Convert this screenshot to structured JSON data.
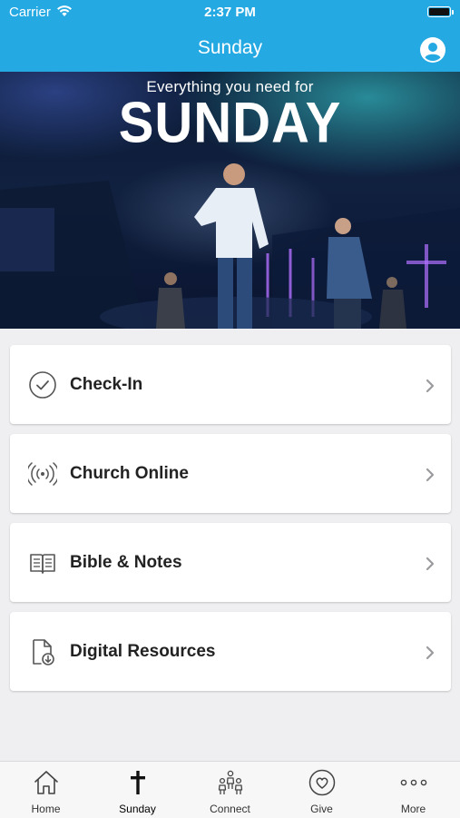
{
  "status_bar": {
    "carrier": "Carrier",
    "time": "2:37 PM"
  },
  "header": {
    "title": "Sunday"
  },
  "hero": {
    "line1": "Everything you need for",
    "line2": "SUNDAY"
  },
  "menu": [
    {
      "label": "Check-In",
      "icon": "check-circle-icon"
    },
    {
      "label": "Church Online",
      "icon": "broadcast-icon"
    },
    {
      "label": "Bible & Notes",
      "icon": "open-book-icon"
    },
    {
      "label": "Digital Resources",
      "icon": "file-download-icon"
    }
  ],
  "tabs": [
    {
      "label": "Home",
      "icon": "home-icon"
    },
    {
      "label": "Sunday",
      "icon": "cross-icon",
      "active": true
    },
    {
      "label": "Connect",
      "icon": "people-icon"
    },
    {
      "label": "Give",
      "icon": "heart-icon"
    },
    {
      "label": "More",
      "icon": "more-dots-icon"
    }
  ],
  "colors": {
    "header": "#25a9e3",
    "background": "#efeff1",
    "card": "#ffffff",
    "text": "#222222"
  }
}
